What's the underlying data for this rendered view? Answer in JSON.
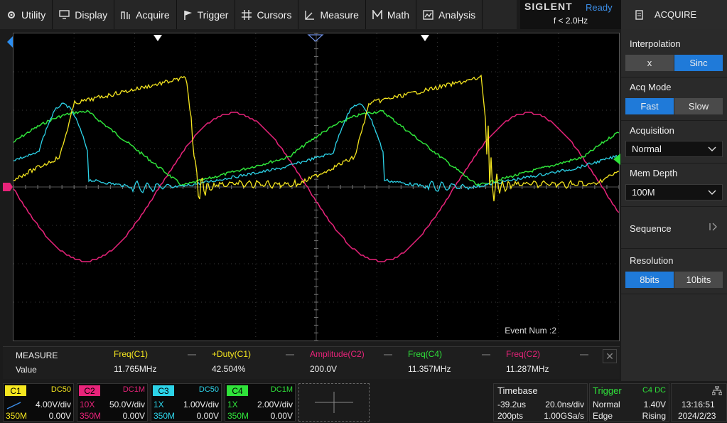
{
  "menu": [
    {
      "label": "Utility",
      "icon": "gear-icon"
    },
    {
      "label": "Display",
      "icon": "monitor-icon"
    },
    {
      "label": "Acquire",
      "icon": "acquire-icon"
    },
    {
      "label": "Trigger",
      "icon": "flag-icon"
    },
    {
      "label": "Cursors",
      "icon": "crosshair-icon"
    },
    {
      "label": "Measure",
      "icon": "ruler-icon"
    },
    {
      "label": "Math",
      "icon": "math-icon"
    },
    {
      "label": "Analysis",
      "icon": "analysis-icon"
    }
  ],
  "brand": {
    "name": "SIGLENT",
    "status": "Ready",
    "trigger_freq": "f < 2.0Hz"
  },
  "panel": {
    "title": "ACQUIRE",
    "interpolation": {
      "label": "Interpolation",
      "options": [
        "x",
        "Sinc"
      ],
      "selected": "Sinc"
    },
    "acq_mode": {
      "label": "Acq Mode",
      "options": [
        "Fast",
        "Slow"
      ],
      "selected": "Fast"
    },
    "acquisition": {
      "label": "Acquisition",
      "value": "Normal"
    },
    "mem_depth": {
      "label": "Mem Depth",
      "value": "100M"
    },
    "sequence": {
      "label": "Sequence"
    },
    "resolution": {
      "label": "Resolution",
      "options": [
        "8bits",
        "10bits"
      ],
      "selected": "8bits"
    }
  },
  "event_num": "Event Num :2",
  "measure": {
    "title": "MEASURE",
    "row_label": "Value",
    "items": [
      {
        "name": "Freq(C1)",
        "value": "11.765MHz",
        "color": "#f5e61f"
      },
      {
        "name": "+Duty(C1)",
        "value": "42.504%",
        "color": "#f5e61f"
      },
      {
        "name": "Amplitude(C2)",
        "value": "200.0V",
        "color": "#e8237a"
      },
      {
        "name": "Freq(C4)",
        "value": "11.357MHz",
        "color": "#2fe23a"
      },
      {
        "name": "Freq(C2)",
        "value": "11.287MHz",
        "color": "#e8237a"
      }
    ]
  },
  "channels": [
    {
      "tag": "C1",
      "coupling": "DC50",
      "probe": "",
      "scale": "4.00V/div",
      "bw": "350M",
      "offset": "0.00V",
      "color": "#f5e61f"
    },
    {
      "tag": "C2",
      "coupling": "DC1M",
      "probe": "10X",
      "scale": "50.0V/div",
      "bw": "350M",
      "offset": "0.00V",
      "color": "#e8237a"
    },
    {
      "tag": "C3",
      "coupling": "DC50",
      "probe": "1X",
      "scale": "1.00V/div",
      "bw": "350M",
      "offset": "0.00V",
      "color": "#2cd3e8"
    },
    {
      "tag": "C4",
      "coupling": "DC1M",
      "probe": "1X",
      "scale": "2.00V/div",
      "bw": "350M",
      "offset": "0.00V",
      "color": "#2fe23a"
    }
  ],
  "timebase": {
    "title": "Timebase",
    "delay": "-39.2us",
    "scale": "20.0ns/div",
    "points": "200pts",
    "rate": "1.00GSa/s"
  },
  "trigger": {
    "title": "Trigger",
    "source": "C4 DC",
    "mode": "Normal",
    "level": "1.40V",
    "type": "Edge",
    "slope": "Rising"
  },
  "clock": {
    "time": "13:16:51",
    "date": "2024/2/23"
  },
  "colors": {
    "accent": "#1f7ad9",
    "c1": "#f5e61f",
    "c2": "#e8237a",
    "c3": "#2cd3e8",
    "c4": "#2fe23a"
  }
}
